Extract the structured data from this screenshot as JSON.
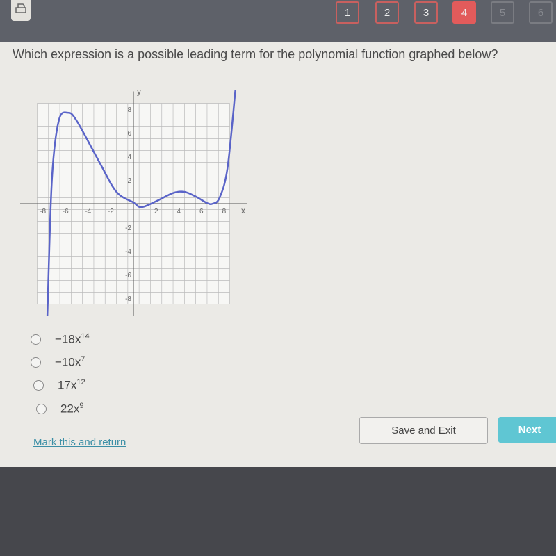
{
  "header": {
    "print_icon": "printer-icon",
    "questions": [
      {
        "label": "1",
        "state": "visited"
      },
      {
        "label": "2",
        "state": "visited"
      },
      {
        "label": "3",
        "state": "visited"
      },
      {
        "label": "4",
        "state": "active"
      },
      {
        "label": "5",
        "state": "disabled"
      },
      {
        "label": "6",
        "state": "disabled"
      }
    ]
  },
  "question": {
    "text": "Which expression is a possible leading term for the polynomial function graphed below?"
  },
  "graph": {
    "x_label": "x",
    "y_label": "y",
    "xlim": [
      -9,
      9
    ],
    "ylim": [
      -9,
      9
    ],
    "grid": true,
    "x_ticks": [
      "-8",
      "-6",
      "-4",
      "-2",
      "2",
      "4",
      "6",
      "8"
    ],
    "y_ticks": [
      "8",
      "6",
      "4",
      "2",
      "-2",
      "-4",
      "-6",
      "-8"
    ],
    "curve_color": "#5a64c8",
    "curve_points": [
      [
        -7.6,
        -9.5
      ],
      [
        -7.2,
        2
      ],
      [
        -6.6,
        7
      ],
      [
        -5.8,
        7.7
      ],
      [
        -5,
        7
      ],
      [
        -3,
        3.5
      ],
      [
        -1.5,
        1
      ],
      [
        0,
        0.1
      ],
      [
        0.7,
        -0.3
      ],
      [
        2,
        0.2
      ],
      [
        3.5,
        0.9
      ],
      [
        4.5,
        1
      ],
      [
        5.5,
        0.6
      ],
      [
        6.5,
        0.05
      ],
      [
        7,
        0
      ],
      [
        7.6,
        0.5
      ],
      [
        8.3,
        3
      ],
      [
        9,
        9.6
      ]
    ]
  },
  "options": [
    {
      "coef": "−18x",
      "exp": "14"
    },
    {
      "coef": "−10x",
      "exp": "7"
    },
    {
      "coef": "17x",
      "exp": "12"
    },
    {
      "coef": "22x",
      "exp": "9"
    }
  ],
  "footer": {
    "mark_label": "Mark this and return",
    "save_label": "Save and Exit",
    "next_label": "Next"
  }
}
